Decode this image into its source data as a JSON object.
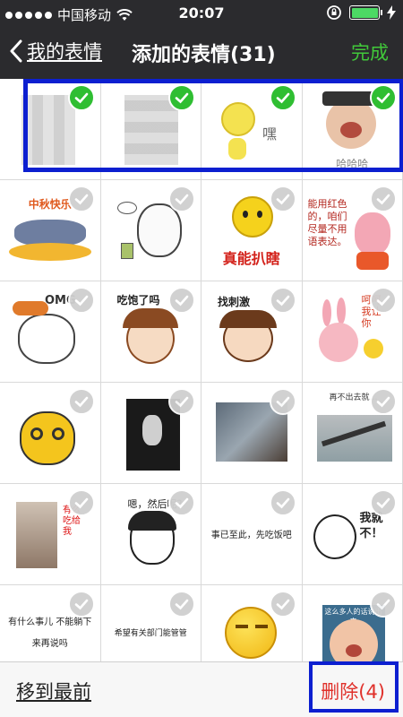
{
  "status_bar": {
    "carrier": "中国移动",
    "time": "20:07"
  },
  "nav": {
    "back_label": "我的表情",
    "title": "添加的表情(31)",
    "done_label": "完成"
  },
  "stickers": {
    "r1c3_text": "嘿",
    "r1c4_text": "哈哈哈",
    "r2c1_text": "中秋快乐",
    "r2c3_text": "真能扒瞎",
    "r2c4_text": "能用红色的，咱们尽量不用语表达。",
    "r3c1_text": "OMG",
    "r3c2_text": "吃饱了吗",
    "r3c3_text": "找刺激",
    "r3c4_text": "呵呵 我让你",
    "r4c4_text": "再不出去就…",
    "r5c1_text": "有么吃给我",
    "r5c2_text": "嗯，然后呢？",
    "r5c3_text": "事已至此，先吃饭吧",
    "r5c4_text": "我就不！",
    "r6c1_text": "有什么事儿 不能躺下来再说吗",
    "r6c2_text": "希望有关部门能管管",
    "r6c4_text": "这么多人的话说出来"
  },
  "bottom": {
    "move_front_label": "移到最前",
    "delete_label": "删除(4)"
  },
  "colors": {
    "accent_green": "#41c93a",
    "delete_red": "#e0302a",
    "annotation_blue": "#0c1fd0"
  }
}
